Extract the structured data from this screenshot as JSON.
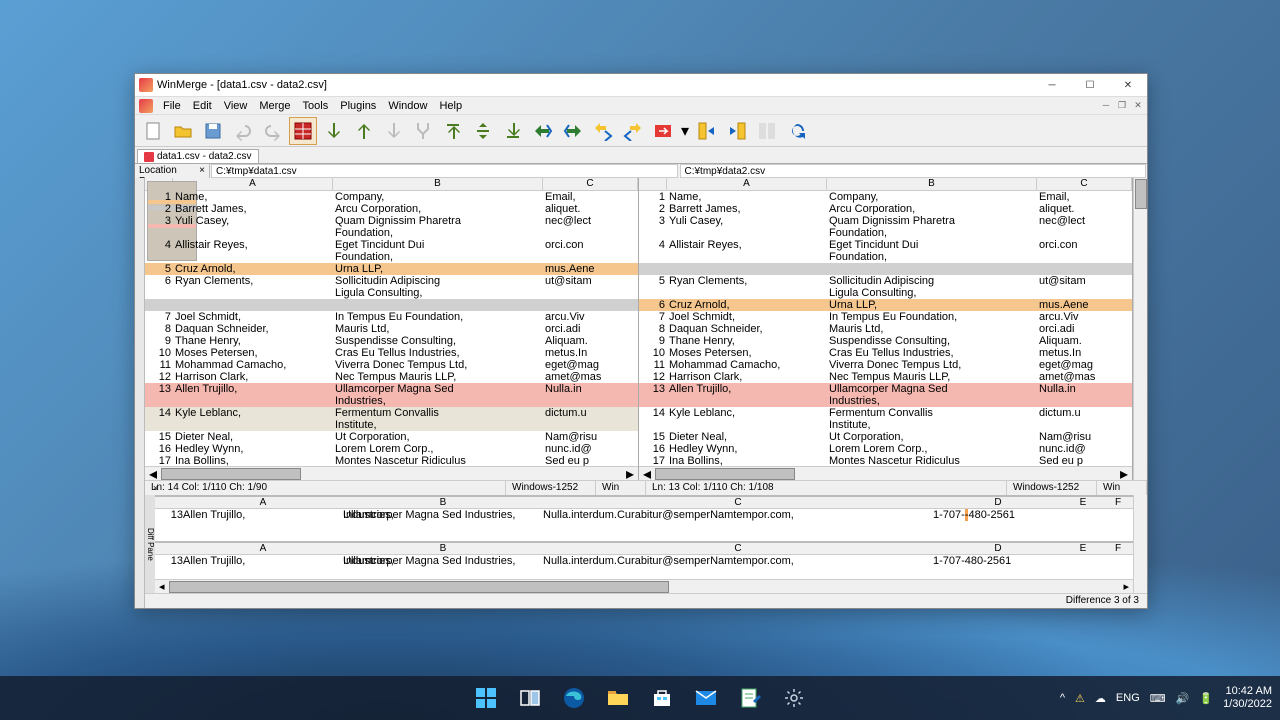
{
  "title": "WinMerge - [data1.csv - data2.csv]",
  "menus": [
    "File",
    "Edit",
    "View",
    "Merge",
    "Tools",
    "Plugins",
    "Window",
    "Help"
  ],
  "tab": "data1.csv - data2.csv",
  "locpane_title": "Location Pane",
  "paths": {
    "left": "C:¥tmp¥data1.csv",
    "right": "C:¥tmp¥data2.csv"
  },
  "cols": [
    "A",
    "B",
    "C"
  ],
  "left_rows": [
    {
      "n": 1,
      "a": "Name,",
      "b": "Company,",
      "c": "Email,"
    },
    {
      "n": 2,
      "a": "Barrett James,",
      "b": "Arcu Corporation,",
      "c": "aliquet."
    },
    {
      "n": 3,
      "a": "Yuli Casey,",
      "b": "Quam Dignissim Pharetra Foundation,",
      "c": "nec@lect"
    },
    {
      "n": 4,
      "a": "Allistair Reyes,",
      "b": "Eget Tincidunt Dui Foundation,",
      "c": "orci.con"
    },
    {
      "n": 5,
      "a": "Cruz Arnold,",
      "b": "Urna LLP,",
      "c": "mus.Aene",
      "cls": "diff-moved"
    },
    {
      "n": 6,
      "a": "Ryan Clements,",
      "b": "Sollicitudin Adipiscing Ligula Consulting,",
      "c": "ut@sitam"
    },
    {
      "n": 0,
      "a": "",
      "b": "",
      "c": "",
      "cls": "diff-blank"
    },
    {
      "n": 7,
      "a": "Joel Schmidt,",
      "b": "In Tempus Eu Foundation,",
      "c": "arcu.Viv"
    },
    {
      "n": 8,
      "a": "Daquan Schneider,",
      "b": "Mauris Ltd,",
      "c": "orci.adi"
    },
    {
      "n": 9,
      "a": "Thane Henry,",
      "b": "Suspendisse Consulting,",
      "c": "Aliquam."
    },
    {
      "n": 10,
      "a": "Moses Petersen,",
      "b": "Cras Eu Tellus Industries,",
      "c": "metus.In"
    },
    {
      "n": 11,
      "a": "Mohammad Camacho,",
      "b": "Viverra Donec Tempus Ltd,",
      "c": "eget@mag"
    },
    {
      "n": 12,
      "a": "Harrison Clark,",
      "b": "Nec Tempus Mauris LLP,",
      "c": "amet@mas"
    },
    {
      "n": 13,
      "a": "Allen Trujillo,",
      "b": "Ullamcorper Magna Sed Industries,",
      "c": "Nulla.in",
      "cls": "diff-changed"
    },
    {
      "n": 14,
      "a": "Kyle Leblanc,",
      "b": "Fermentum Convallis Institute,",
      "c": "dictum.u",
      "cls": "selected"
    },
    {
      "n": 15,
      "a": "Dieter Neal,",
      "b": "Ut Corporation,",
      "c": "Nam@risu"
    },
    {
      "n": 16,
      "a": "Hedley Wynn,",
      "b": "Lorem Lorem Corp.,",
      "c": "nunc.id@"
    },
    {
      "n": 17,
      "a": "Ina Bollins,",
      "b": "Montes Nascetur Ridiculus",
      "c": "Sed eu p"
    }
  ],
  "right_rows": [
    {
      "n": 1,
      "a": "Name,",
      "b": "Company,",
      "c": "Email,"
    },
    {
      "n": 2,
      "a": "Barrett James,",
      "b": "Arcu Corporation,",
      "c": "aliquet."
    },
    {
      "n": 3,
      "a": "Yuli Casey,",
      "b": "Quam Dignissim Pharetra Foundation,",
      "c": "nec@lect"
    },
    {
      "n": 4,
      "a": "Allistair Reyes,",
      "b": "Eget Tincidunt Dui Foundation,",
      "c": "orci.con"
    },
    {
      "n": 0,
      "a": "",
      "b": "",
      "c": "",
      "cls": "diff-blank"
    },
    {
      "n": 5,
      "a": "Ryan Clements,",
      "b": "Sollicitudin Adipiscing Ligula Consulting,",
      "c": "ut@sitam"
    },
    {
      "n": 6,
      "a": "Cruz Arnold,",
      "b": "Urna LLP,",
      "c": "mus.Aene",
      "cls": "diff-moved"
    },
    {
      "n": 7,
      "a": "Joel Schmidt,",
      "b": "In Tempus Eu Foundation,",
      "c": "arcu.Viv"
    },
    {
      "n": 8,
      "a": "Daquan Schneider,",
      "b": "Mauris Ltd,",
      "c": "orci.adi"
    },
    {
      "n": 9,
      "a": "Thane Henry,",
      "b": "Suspendisse Consulting,",
      "c": "Aliquam."
    },
    {
      "n": 10,
      "a": "Moses Petersen,",
      "b": "Cras Eu Tellus Industries,",
      "c": "metus.In"
    },
    {
      "n": 11,
      "a": "Mohammad Camacho,",
      "b": "Viverra Donec Tempus Ltd,",
      "c": "eget@mag"
    },
    {
      "n": 12,
      "a": "Harrison Clark,",
      "b": "Nec Tempus Mauris LLP,",
      "c": "amet@mas"
    },
    {
      "n": 13,
      "a": "Allen Trujillo,",
      "b": "Ullamcorper Magna Sed Industries,",
      "c": "Nulla.in",
      "cls": "diff-changed"
    },
    {
      "n": 14,
      "a": "Kyle Leblanc,",
      "b": "Fermentum Convallis Institute,",
      "c": "dictum.u"
    },
    {
      "n": 15,
      "a": "Dieter Neal,",
      "b": "Ut Corporation,",
      "c": "Nam@risu"
    },
    {
      "n": 16,
      "a": "Hedley Wynn,",
      "b": "Lorem Lorem Corp.,",
      "c": "nunc.id@"
    },
    {
      "n": 17,
      "a": "Ina Bollins,",
      "b": "Montes Nascetur Ridiculus",
      "c": "Sed eu p"
    }
  ],
  "status": {
    "left_pos": "Ln: 14  Col: 1/110  Ch: 1/90",
    "right_pos": "Ln: 13  Col: 1/110  Ch: 1/108",
    "encoding": "Windows-1252",
    "eol": "Win"
  },
  "diff_cols": [
    "A",
    "B",
    "C",
    "D",
    "E",
    "F"
  ],
  "diff_top": {
    "n": "13",
    "a": "Allen Trujillo,",
    "b": "Ullamcorper Magna Sed Industries,",
    "c": "Nulla.interdum.Curabitur@semperNamtempor.com,",
    "d_pre": "1-707-",
    "d_hl": "-",
    "d_post": "480-2561"
  },
  "diff_bot": {
    "n": "13",
    "a": "Allen Trujillo,",
    "b": "Ullamcorper Magna Sed Industries,",
    "c": "Nulla.interdum.Curabitur@semperNamtempor.com,",
    "d": "1-707-480-2561"
  },
  "diff_side": "Diff Pane",
  "diff_status": "Difference 3 of 3",
  "tray": {
    "lang": "ENG",
    "time": "10:42 AM",
    "date": "1/30/2022"
  }
}
